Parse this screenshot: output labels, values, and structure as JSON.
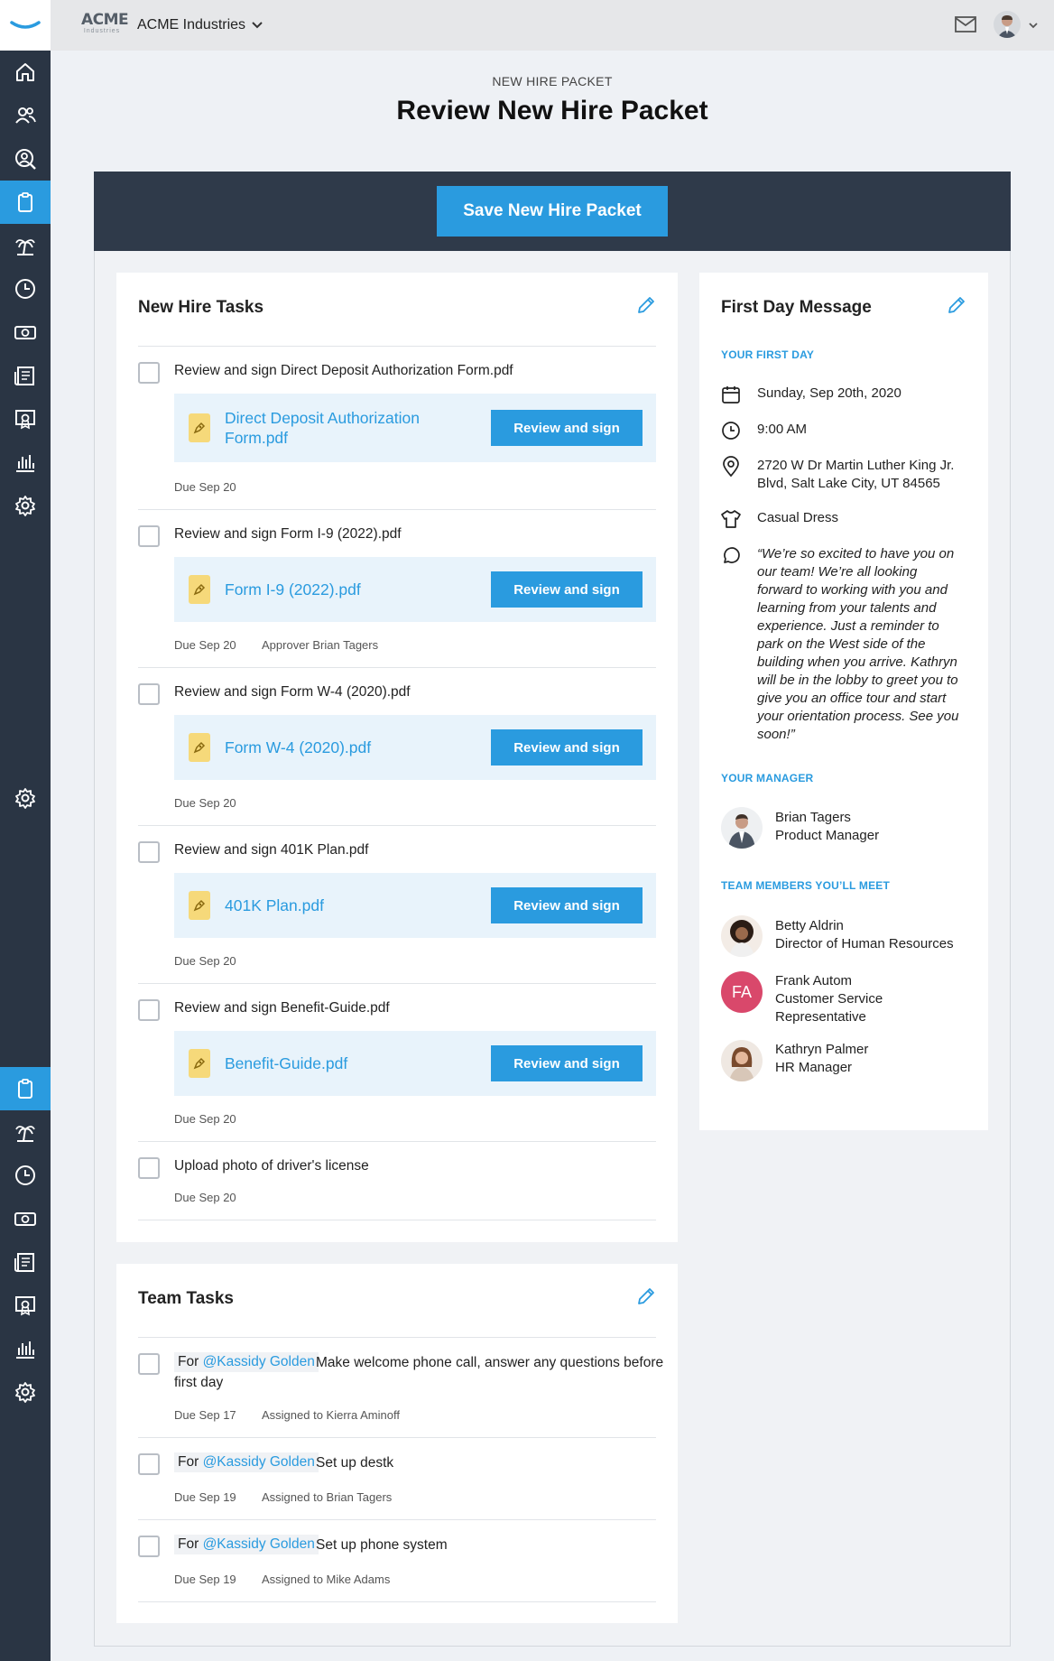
{
  "topbar": {
    "logo_big": "ACME",
    "logo_small": "Industries",
    "company": "ACME Industries"
  },
  "header": {
    "subtitle": "NEW HIRE PACKET",
    "title": "Review New Hire Packet",
    "save_label": "Save New Hire Packet"
  },
  "new_hire_tasks": {
    "title": "New Hire Tasks",
    "tasks": [
      {
        "label": "Review and sign Direct Deposit Authorization Form.pdf",
        "file_line1": "Direct Deposit Authorization",
        "file_line2": "Form.pdf",
        "button": "Review and sign",
        "due": "Due Sep 20",
        "approver": ""
      },
      {
        "label": "Review and sign Form I-9 (2022).pdf",
        "file_line1": "Form I-9 (2022).pdf",
        "file_line2": "",
        "button": "Review and sign",
        "due": "Due Sep 20",
        "approver": "Approver Brian Tagers"
      },
      {
        "label": "Review and sign Form W-4 (2020).pdf",
        "file_line1": "Form W-4 (2020).pdf",
        "file_line2": "",
        "button": "Review and sign",
        "due": "Due Sep 20",
        "approver": ""
      },
      {
        "label": "Review and sign 401K Plan.pdf",
        "file_line1": "401K Plan.pdf",
        "file_line2": "",
        "button": "Review and sign",
        "due": "Due Sep 20",
        "approver": ""
      },
      {
        "label": "Review and sign Benefit-Guide.pdf",
        "file_line1": "Benefit-Guide.pdf",
        "file_line2": "",
        "button": "Review and sign",
        "due": "Due Sep 20",
        "approver": ""
      }
    ],
    "upload_task": {
      "label": "Upload photo of driver's license",
      "due": "Due Sep 20"
    }
  },
  "team_tasks": {
    "title": "Team Tasks",
    "tasks": [
      {
        "for": "For",
        "mention": "@Kassidy Golden",
        "text_line1": "Make welcome phone call, answer any questions before",
        "text_line2": "first day",
        "due": "Due Sep 17",
        "assigned": "Assigned to Kierra Aminoff"
      },
      {
        "for": "For",
        "mention": "@Kassidy Golden",
        "text_line1": "Set up destk",
        "text_line2": "",
        "due": "Due Sep 19",
        "assigned": "Assigned to Brian Tagers"
      },
      {
        "for": "For",
        "mention": "@Kassidy Golden",
        "text_line1": "Set up phone system",
        "text_line2": "",
        "due": "Due Sep 19",
        "assigned": "Assigned to Mike Adams"
      }
    ]
  },
  "first_day": {
    "title": "First Day Message",
    "your_first_day_label": "YOUR FIRST DAY",
    "date": "Sunday, Sep 20th, 2020",
    "time": "9:00 AM",
    "address_line1": "2720 W Dr Martin Luther King Jr.",
    "address_line2": "Blvd, Salt Lake City, UT 84565",
    "dress": "Casual Dress",
    "message_lines": [
      "“We’re so excited to have you on",
      "our team! We’re all looking",
      "forward to working with you and",
      "learning from your talents and",
      "experience. Just a reminder to",
      "park on the West side of the",
      "building when you arrive. Kathryn",
      "will be in the lobby to greet you to",
      "give you an office tour and start",
      "your orientation process. See you",
      "soon!”"
    ],
    "manager_label": "YOUR MANAGER",
    "manager": {
      "name": "Brian Tagers",
      "role": "Product Manager"
    },
    "team_label": "TEAM MEMBERS YOU’LL MEET",
    "team": [
      {
        "name": "Betty Aldrin",
        "role": "Director of Human Resources",
        "initials": ""
      },
      {
        "name": "Frank Autom",
        "role": "Customer Service",
        "role2": "Representative",
        "initials": "FA"
      },
      {
        "name": "Kathryn Palmer",
        "role": "HR Manager",
        "initials": ""
      }
    ]
  },
  "colors": {
    "accent": "#2a9bdf",
    "sidebar": "#2a3544",
    "header_band": "#2f3a4a",
    "file_bg": "#e8f3fb",
    "initials_bg": "#d9486b"
  },
  "icons": {
    "sidebar": [
      "home-icon",
      "people-icon",
      "person-search-icon",
      "clipboard-icon",
      "palm-tree-icon",
      "clock-icon",
      "money-icon",
      "news-icon",
      "certificate-icon",
      "chart-icon",
      "gear-icon"
    ]
  }
}
